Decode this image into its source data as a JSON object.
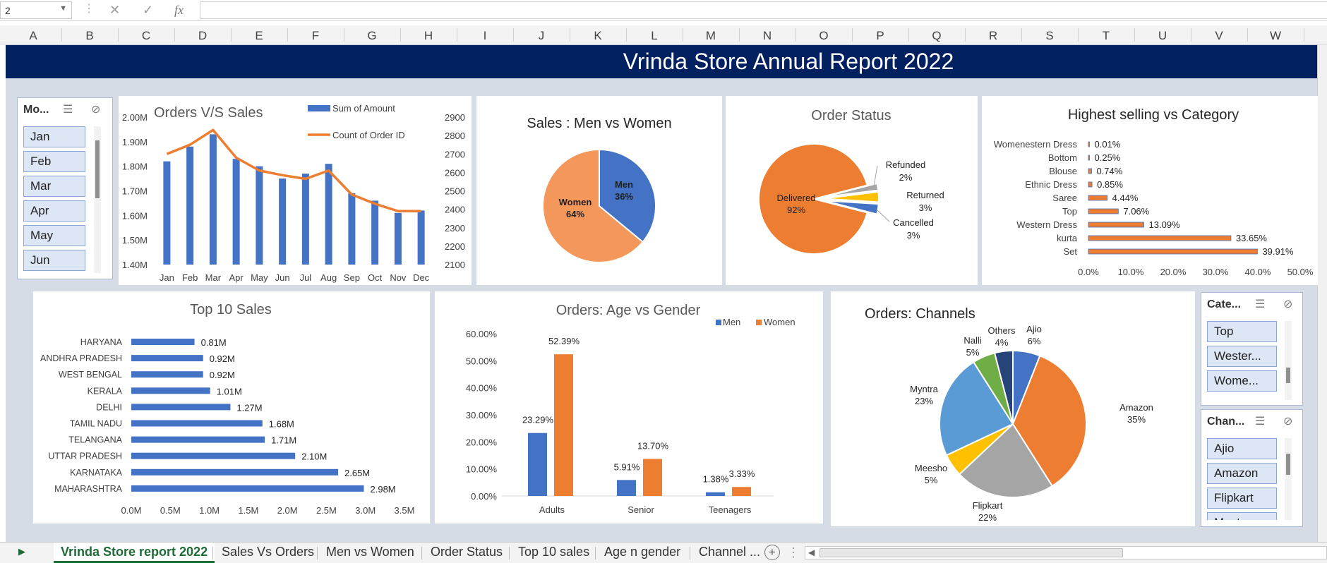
{
  "namebox": {
    "value": "2"
  },
  "columns": [
    "A",
    "B",
    "C",
    "D",
    "E",
    "F",
    "G",
    "H",
    "I",
    "J",
    "K",
    "L",
    "M",
    "N",
    "O",
    "P",
    "Q",
    "R",
    "S",
    "T",
    "U",
    "V",
    "W"
  ],
  "banner": {
    "title": "Vrinda Store Annual Report 2022"
  },
  "month_slicer": {
    "header": "Mo...",
    "items": [
      "Jan",
      "Feb",
      "Mar",
      "Apr",
      "May",
      "Jun"
    ]
  },
  "category_slicer": {
    "header": "Cate...",
    "items": [
      "Top",
      "Wester...",
      "Wome..."
    ]
  },
  "channel_slicer": {
    "header": "Chan...",
    "items": [
      "Ajio",
      "Amazon",
      "Flipkart",
      "Myntra"
    ]
  },
  "colors": {
    "blue": "#4472c4",
    "orange": "#ed7d31",
    "gray": "#a5a5a5",
    "yellow": "#ffc000",
    "lightblue": "#5b9bd5",
    "green": "#70ad47",
    "navy": "#264478",
    "banner": "#002060"
  },
  "chart_data": [
    {
      "id": "orders_vs_sales",
      "type": "bar",
      "title": "Orders V/S Sales",
      "categories": [
        "Jan",
        "Feb",
        "Mar",
        "Apr",
        "May",
        "Jun",
        "Jul",
        "Aug",
        "Sep",
        "Oct",
        "Nov",
        "Dec"
      ],
      "series": [
        {
          "name": "Sum of Amount",
          "values": [
            1.82,
            1.88,
            1.93,
            1.83,
            1.8,
            1.75,
            1.77,
            1.81,
            1.69,
            1.66,
            1.61,
            1.62
          ],
          "axis": "left"
        },
        {
          "name": "Count of Order ID",
          "type": "line",
          "values": [
            2700,
            2750,
            2830,
            2680,
            2610,
            2585,
            2565,
            2610,
            2480,
            2430,
            2390,
            2390
          ],
          "axis": "right"
        }
      ],
      "y_left_ticks": [
        "2.00M",
        "1.90M",
        "1.80M",
        "1.70M",
        "1.60M",
        "1.50M",
        "1.40M"
      ],
      "y_right_ticks": [
        "2900",
        "2800",
        "2700",
        "2600",
        "2500",
        "2400",
        "2300",
        "2200",
        "2100"
      ],
      "ylim": [
        1.4,
        2.0
      ],
      "y2lim": [
        2100,
        2900
      ]
    },
    {
      "id": "men_vs_women",
      "type": "pie",
      "title": "Sales : Men vs Women",
      "slices": [
        {
          "label": "Men",
          "pct": "36%",
          "value": 36
        },
        {
          "label": "Women",
          "pct": "64%",
          "value": 64
        }
      ]
    },
    {
      "id": "order_status",
      "type": "pie",
      "title": "Order Status",
      "slices": [
        {
          "label": "Delivered",
          "pct": "92%",
          "value": 92
        },
        {
          "label": "Refunded",
          "pct": "2%",
          "value": 2
        },
        {
          "label": "Returned",
          "pct": "3%",
          "value": 3
        },
        {
          "label": "Cancelled",
          "pct": "3%",
          "value": 3
        }
      ]
    },
    {
      "id": "category",
      "type": "bar",
      "orientation": "horizontal",
      "title": "Highest selling vs Category",
      "categories": [
        "Womenestern Dress",
        "Bottom",
        "Blouse",
        "Ethnic Dress",
        "Saree",
        "Top",
        "Western Dress",
        "kurta",
        "Set"
      ],
      "values": [
        0.01,
        0.25,
        0.74,
        0.85,
        4.44,
        7.06,
        13.09,
        33.65,
        39.91
      ],
      "labels": [
        "0.01%",
        "0.25%",
        "0.74%",
        "0.85%",
        "4.44%",
        "7.06%",
        "13.09%",
        "33.65%",
        "39.91%"
      ],
      "x_ticks": [
        "0.0%",
        "10.0%",
        "20.0%",
        "30.0%",
        "40.0%",
        "50.0%"
      ],
      "xlim": [
        0,
        50
      ]
    },
    {
      "id": "top10",
      "type": "bar",
      "orientation": "horizontal",
      "title": "Top 10 Sales",
      "categories": [
        "HARYANA",
        "ANDHRA PRADESH",
        "WEST BENGAL",
        "KERALA",
        "DELHI",
        "TAMIL NADU",
        "TELANGANA",
        "UTTAR PRADESH",
        "KARNATAKA",
        "MAHARASHTRA"
      ],
      "values": [
        0.81,
        0.92,
        0.92,
        1.01,
        1.27,
        1.68,
        1.71,
        2.1,
        2.65,
        2.98
      ],
      "labels": [
        "0.81M",
        "0.92M",
        "0.92M",
        "1.01M",
        "1.27M",
        "1.68M",
        "1.71M",
        "2.10M",
        "2.65M",
        "2.98M"
      ],
      "x_ticks": [
        "0.0M",
        "0.5M",
        "1.0M",
        "1.5M",
        "2.0M",
        "2.5M",
        "3.0M",
        "3.5M"
      ],
      "xlim": [
        0,
        3.5
      ]
    },
    {
      "id": "age_gender",
      "type": "bar",
      "title": "Orders: Age vs Gender",
      "categories": [
        "Adults",
        "Senior",
        "Teenagers"
      ],
      "series": [
        {
          "name": "Men",
          "values": [
            23.29,
            5.91,
            1.38
          ],
          "labels": [
            "23.29%",
            "5.91%",
            "1.38%"
          ]
        },
        {
          "name": "Women",
          "values": [
            52.39,
            13.7,
            3.33
          ],
          "labels": [
            "52.39%",
            "13.70%",
            "3.33%"
          ]
        }
      ],
      "y_ticks": [
        "60.00%",
        "50.00%",
        "40.00%",
        "30.00%",
        "20.00%",
        "10.00%",
        "0.00%"
      ],
      "ylim": [
        0,
        60
      ]
    },
    {
      "id": "channels",
      "type": "pie",
      "title": "Orders: Channels",
      "slices": [
        {
          "label": "Ajio",
          "pct": "6%",
          "value": 6
        },
        {
          "label": "Amazon",
          "pct": "35%",
          "value": 35
        },
        {
          "label": "Flipkart",
          "pct": "22%",
          "value": 22
        },
        {
          "label": "Meesho",
          "pct": "5%",
          "value": 5
        },
        {
          "label": "Myntra",
          "pct": "23%",
          "value": 23
        },
        {
          "label": "Nalli",
          "pct": "5%",
          "value": 5
        },
        {
          "label": "Others",
          "pct": "4%",
          "value": 4
        }
      ]
    }
  ],
  "tabs": [
    "Vrinda Store report 2022",
    "Sales Vs Orders",
    "Men vs Women",
    "Order Status",
    "Top 10 sales",
    "Age n gender",
    "Channel ..."
  ]
}
